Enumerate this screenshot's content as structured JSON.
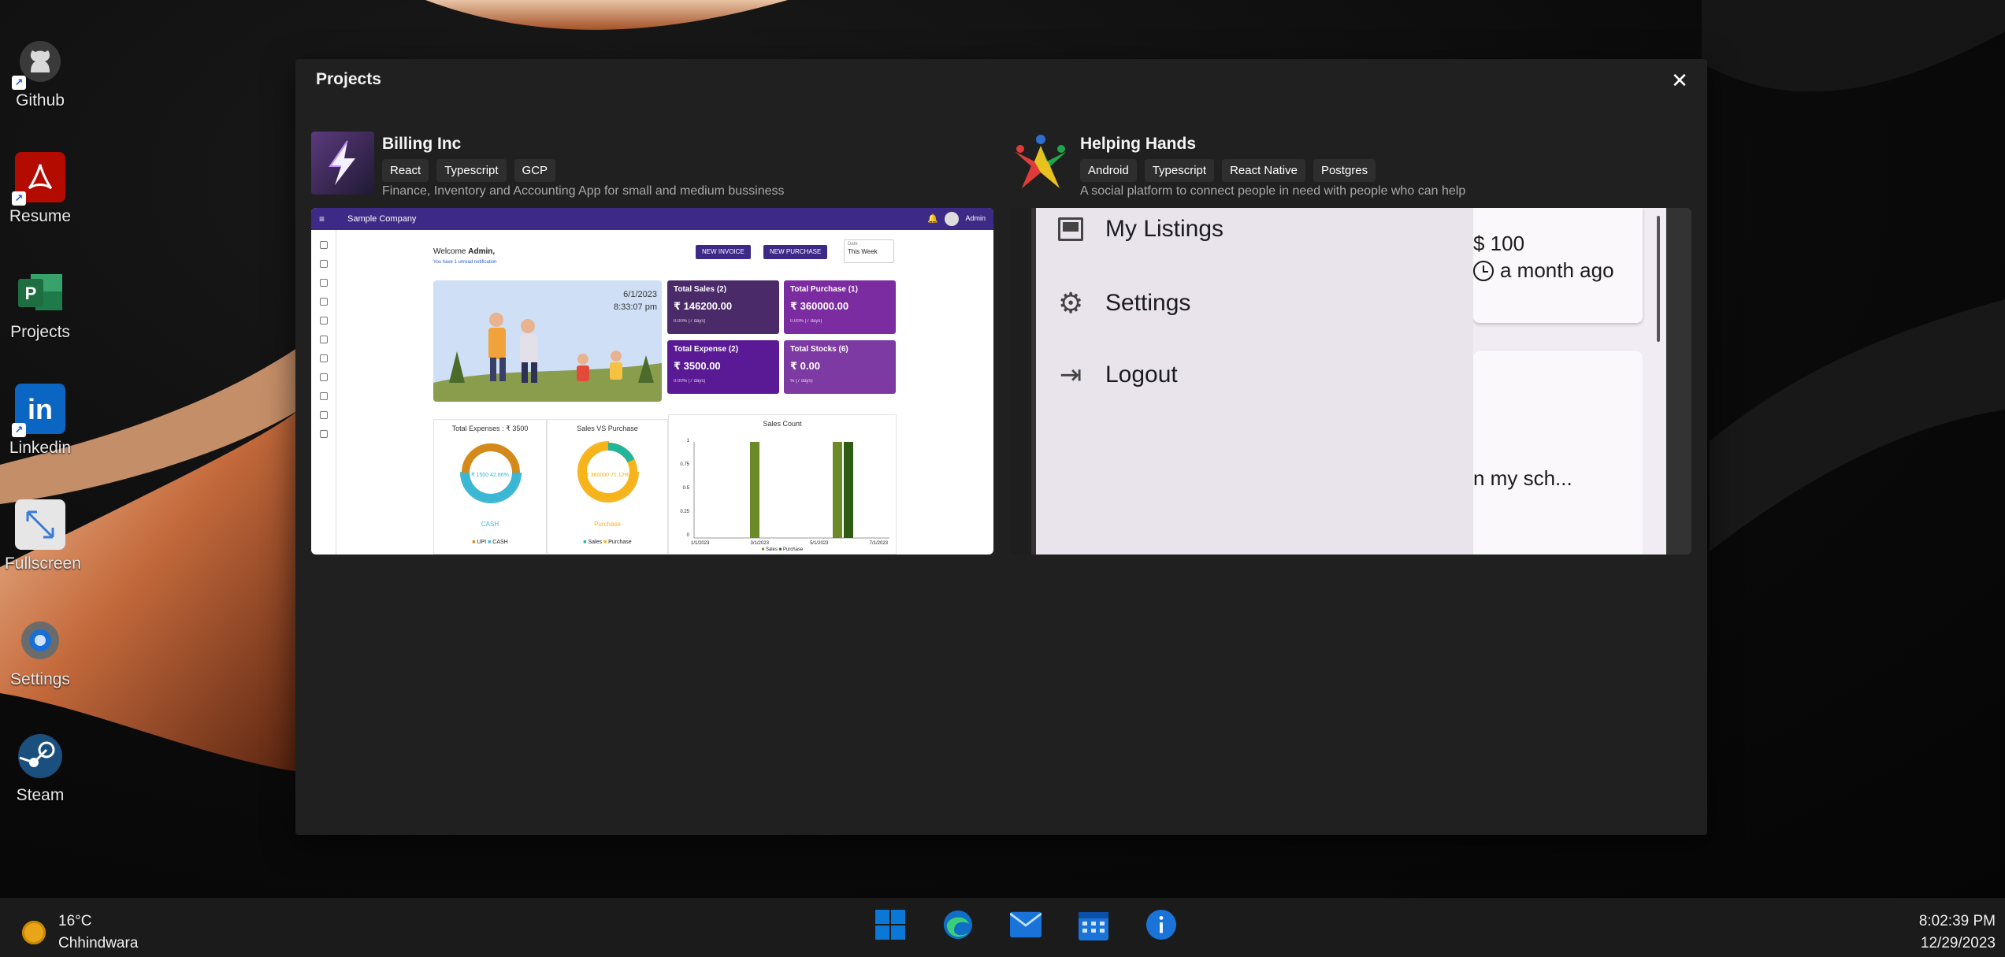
{
  "desktop": {
    "icons": [
      {
        "label": "Github"
      },
      {
        "label": "Resume"
      },
      {
        "label": "Projects"
      },
      {
        "label": "Linkedin"
      },
      {
        "label": "Fullscreen"
      },
      {
        "label": "Settings"
      },
      {
        "label": "Steam"
      }
    ]
  },
  "window": {
    "title": "Projects",
    "close_glyph": "✕"
  },
  "projects": [
    {
      "name": "Billing Inc",
      "tags": [
        "React",
        "Typescript",
        "GCP"
      ],
      "description": "Finance, Inventory and Accounting App for small and medium bussiness",
      "screenshot": {
        "company": "Sample Company",
        "user": "Admin",
        "welcome_prefix": "Welcome ",
        "welcome_name": "Admin,",
        "notifications": "You have 1 unread notification",
        "new_invoice": "NEW INVOICE",
        "new_purchase": "NEW PURCHASE",
        "range_label": "Date",
        "range_value": "This Week",
        "date": "6/1/2023",
        "time": "8:33:07 pm",
        "stats": [
          {
            "title": "Total Sales (2)",
            "value": "₹ 146200.00",
            "color": "#4b2a6a"
          },
          {
            "title": "Total Purchase (1)",
            "value": "₹ 360000.00",
            "color": "#7b2ca0"
          },
          {
            "title": "Total Expense (2)",
            "value": "₹ 3500.00",
            "color": "#5a1a95"
          },
          {
            "title": "Total Stocks (6)",
            "value": "₹ 0.00",
            "color": "#7d3aa2"
          }
        ],
        "panel_expenses": "Total Expenses : ₹ 3500",
        "panel_svp": "Sales VS Purchase",
        "panel_count": "Sales Count",
        "donut1_center": "₹ 1500 42.86%",
        "donut1_label": "CASH",
        "donut1_legend": [
          "UPI",
          "CASH"
        ],
        "donut2_center": "₹ 360000 71.12%",
        "donut2_label": "Purchase",
        "donut2_legend": [
          "Sales",
          "Purchase"
        ],
        "bar_x_labels": [
          "1/1/2023",
          "3/1/2023",
          "5/1/2023",
          "7/1/2023"
        ],
        "bar_y_labels": [
          "1",
          "0.75",
          "0.5",
          "0.25",
          "0"
        ],
        "bar_legend": [
          "Sales",
          "Purchase"
        ]
      }
    },
    {
      "name": "Helping Hands",
      "tags": [
        "Android",
        "Typescript",
        "React Native",
        "Postgres"
      ],
      "description": "A social platform to connect people in need with people who can help",
      "screenshot": {
        "menu": [
          "My Listings",
          "Settings",
          "Logout"
        ],
        "price": "$ 100",
        "time_ago": "a month ago",
        "snippet": "n my sch..."
      }
    }
  ],
  "taskbar": {
    "temperature": "16°C",
    "city": "Chhindwara",
    "time": "8:02:39 PM",
    "date": "12/29/2023",
    "apps": [
      "start-icon",
      "edge-icon",
      "mail-icon",
      "calendar-icon",
      "info-icon"
    ]
  }
}
